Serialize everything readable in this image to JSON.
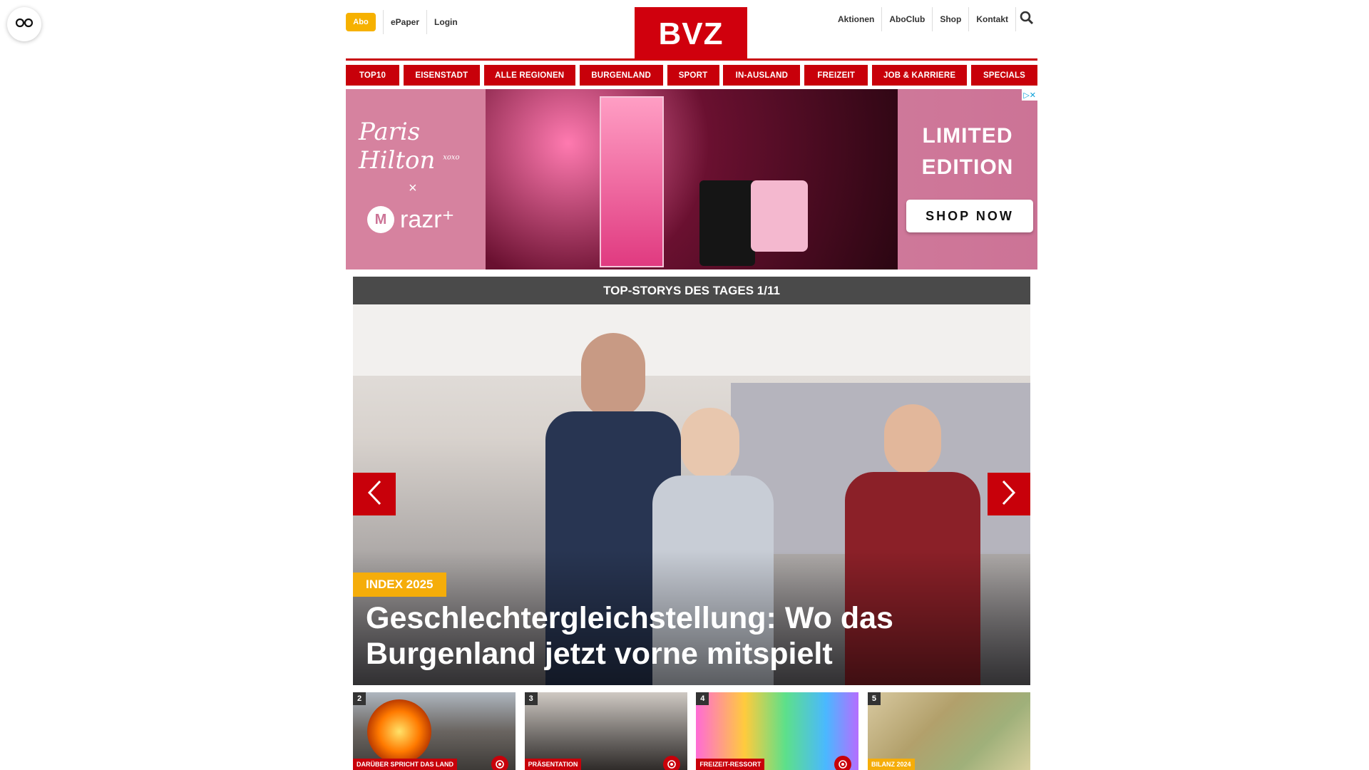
{
  "header": {
    "abo_label": "Abo",
    "left_links": [
      "ePaper",
      "Login"
    ],
    "logo_text": "BVZ",
    "right_links": [
      "Aktionen",
      "AboClub",
      "Shop",
      "Kontakt"
    ]
  },
  "nav": {
    "items": [
      "TOP10",
      "EISENSTADT",
      "ALLE REGIONEN",
      "BURGENLAND",
      "SPORT",
      "IN-AUSLAND",
      "FREIZEIT",
      "JOB & KARRIERE",
      "SPECIALS"
    ]
  },
  "ad": {
    "signature": "Paris Hilton",
    "signature_suffix": "xoxo",
    "cross": "×",
    "brand_logo": "M",
    "brand": "razr⁺",
    "headline_line1": "LIMITED",
    "headline_line2": "EDITION",
    "cta": "SHOP NOW",
    "adchoices": "▷✕"
  },
  "top_story": {
    "header": "TOP-STORYS DES TAGES 1/11",
    "kicker": "INDEX 2025",
    "headline": "Geschlechtergleichstellung: Wo das Burgenland jetzt vorne mitspielt"
  },
  "thumbnails": [
    {
      "number": "2",
      "tag": "DARÜBER SPRICHT DAS LAND",
      "tag_color": "red",
      "has_camera": true
    },
    {
      "number": "3",
      "tag": "PRÄSENTATION",
      "tag_color": "red",
      "has_camera": true
    },
    {
      "number": "4",
      "tag": "FREIZEIT-RESSORT",
      "tag_color": "red",
      "has_camera": true
    },
    {
      "number": "5",
      "tag": "BILANZ 2024",
      "tag_color": "yellow",
      "has_camera": false
    }
  ],
  "colors": {
    "brand_red": "#c8000a",
    "abo_yellow": "#f6b100",
    "slider_header": "#4a4a4a"
  },
  "icons": {
    "reader": "glasses-icon",
    "search": "search-icon",
    "prev": "chevron-left-icon",
    "next": "chevron-right-icon",
    "camera": "camera-icon"
  }
}
